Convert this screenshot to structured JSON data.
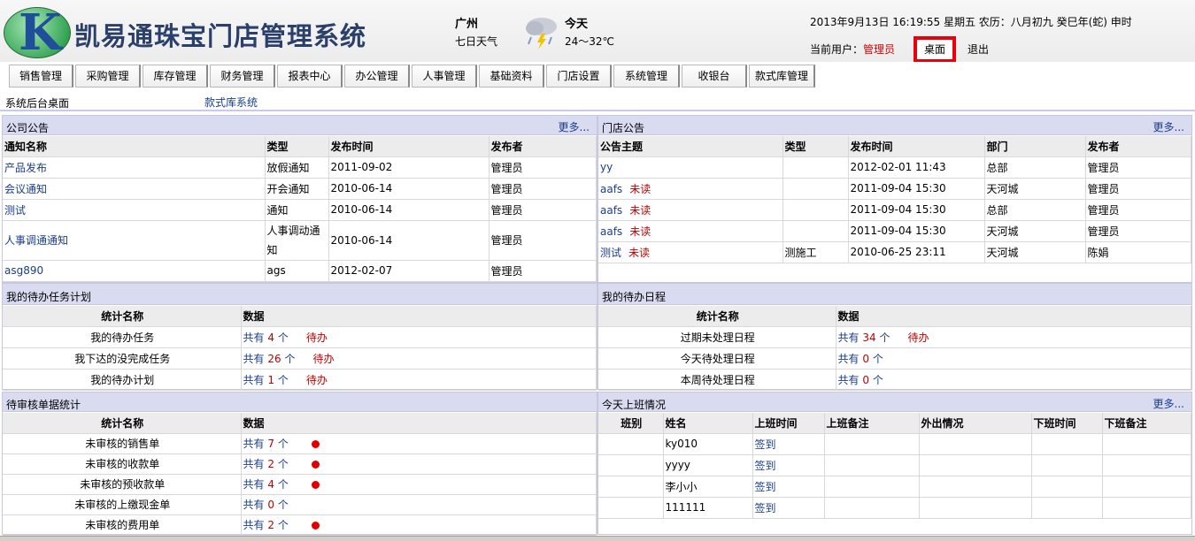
{
  "header": {
    "logo_letter": "K",
    "title": "凯易通珠宝门店管理系统",
    "city": "广州",
    "forecast": "七日天气",
    "today_label": "今天",
    "temperature": "24～32℃",
    "datetime": "2013年9月13日  16:19:55 星期五  农历：八月初九  癸巳年(蛇) 申时",
    "current_user_label": "当前用户：",
    "current_user": "管理员",
    "desk_button": "桌面",
    "logout": "退出"
  },
  "nav": [
    "销售管理",
    "采购管理",
    "库存管理",
    "财务管理",
    "报表中心",
    "办公管理",
    "人事管理",
    "基础资料",
    "门店设置",
    "系统管理",
    "收银台",
    "款式库管理"
  ],
  "breadcrumb": {
    "left": "系统后台桌面",
    "right": "款式库系统"
  },
  "company_notices": {
    "title": "公司公告",
    "more": "更多...",
    "headers": [
      "通知名称",
      "类型",
      "发布时间",
      "发布者"
    ],
    "rows": [
      [
        "产品发布",
        "放假通知",
        "2011-09-02",
        "管理员"
      ],
      [
        "会议通知",
        "开会通知",
        "2010-06-14",
        "管理员"
      ],
      [
        "测试",
        "通知",
        "2010-06-14",
        "管理员"
      ],
      [
        "人事调通通知",
        "人事调动通知",
        "2010-06-14",
        "管理员"
      ],
      [
        "asg890",
        "ags",
        "2012-02-07",
        "管理员"
      ]
    ]
  },
  "store_notices": {
    "title": "门店公告",
    "more": "更多...",
    "headers": [
      "公告主题",
      "类型",
      "发布时间",
      "部门",
      "发布者"
    ],
    "unread": "未读",
    "rows": [
      [
        "yy",
        "",
        "2012-02-01 11:43",
        "总部",
        "管理员",
        false
      ],
      [
        "aafs",
        "",
        "2011-09-04 15:30",
        "天河城",
        "管理员",
        true
      ],
      [
        "aafs",
        "",
        "2011-09-04 15:30",
        "总部",
        "管理员",
        true
      ],
      [
        "aafs",
        "",
        "2011-09-04 15:30",
        "天河城",
        "管理员",
        true
      ],
      [
        "测试",
        "测施工",
        "2010-06-25 23:11",
        "天河城",
        "陈娟",
        true
      ]
    ]
  },
  "tasks": {
    "title": "我的待办任务计划",
    "headers": [
      "统计名称",
      "数据"
    ],
    "total_prefix": "共有",
    "unit": "个",
    "pending": "待办",
    "rows": [
      {
        "name": "我的待办任务",
        "count": "4"
      },
      {
        "name": "我下达的没完成任务",
        "count": "26"
      },
      {
        "name": "我的待办计划",
        "count": "1"
      }
    ]
  },
  "schedule": {
    "title": "我的待办日程",
    "headers": [
      "统计名称",
      "数据"
    ],
    "total_prefix": "共有",
    "unit": "个",
    "pending": "待办",
    "rows": [
      {
        "name": "过期未处理日程",
        "count": "34",
        "pending": true
      },
      {
        "name": "今天待处理日程",
        "count": "0",
        "pending": false
      },
      {
        "name": "本周待处理日程",
        "count": "0",
        "pending": false
      }
    ]
  },
  "review": {
    "title": "待审核单据统计",
    "headers": [
      "统计名称",
      "数据"
    ],
    "total_prefix": "共有",
    "unit": "个",
    "rows": [
      {
        "name": "未审核的销售单",
        "count": "7",
        "dot": true
      },
      {
        "name": "未审核的收款单",
        "count": "2",
        "dot": true
      },
      {
        "name": "未审核的预收款单",
        "count": "4",
        "dot": true
      },
      {
        "name": "未审核的上缴现金单",
        "count": "0",
        "dot": false
      },
      {
        "name": "未审核的费用单",
        "count": "2",
        "dot": true
      }
    ]
  },
  "attendance": {
    "title": "今天上班情况",
    "more": "更多...",
    "headers": [
      "班别",
      "姓名",
      "上班时间",
      "上班备注",
      "外出情况",
      "下班时间",
      "下班备注"
    ],
    "checkin": "签到",
    "rows": [
      {
        "name": "ky010"
      },
      {
        "name": "yyyy"
      },
      {
        "name": "李小小"
      },
      {
        "name": "111111"
      }
    ]
  },
  "colors": {
    "accent_red": "#e8000b",
    "link": "#1a3e8c",
    "panel_header": "#d9dbf1"
  }
}
